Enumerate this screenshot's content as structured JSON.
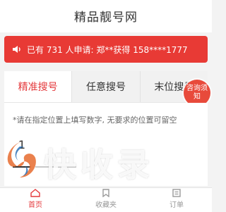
{
  "header": {
    "title": "精品靓号网"
  },
  "notice": {
    "text": "已有 731 人申请:  郑**获得 158****1777"
  },
  "tabs": [
    {
      "label": "精准搜号",
      "active": true
    },
    {
      "label": "任意搜号",
      "active": false
    },
    {
      "label": "末位搜号",
      "active": false
    }
  ],
  "consult": {
    "label": "咨询须知"
  },
  "panel": {
    "tip": "*请在指定位置上填写数字, 无要求的位置可留空",
    "first_digit": "1"
  },
  "watermark": {
    "text": "快收录"
  },
  "tabbar": [
    {
      "label": "首页",
      "icon": "home-icon",
      "active": true
    },
    {
      "label": "收藏夹",
      "icon": "favorites-icon",
      "active": false
    },
    {
      "label": "订单",
      "icon": "order-icon",
      "active": false
    }
  ],
  "colors": {
    "accent": "#e4393c",
    "notice_bg": "#e83a35"
  }
}
